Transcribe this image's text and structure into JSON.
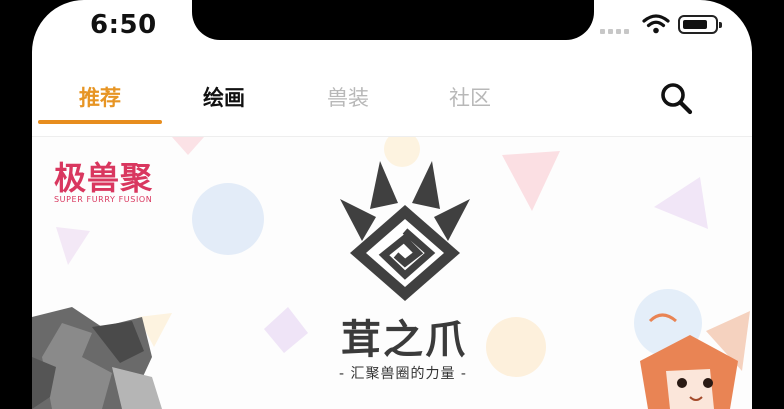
{
  "status_bar": {
    "time": "6:50"
  },
  "tabs": [
    {
      "label": "推荐",
      "active": true
    },
    {
      "label": "绘画",
      "active": false
    },
    {
      "label": "兽装",
      "active": false
    },
    {
      "label": "社区",
      "active": false
    }
  ],
  "icons": {
    "search": "search-icon",
    "wifi": "wifi-icon",
    "battery": "battery-icon"
  },
  "banner": {
    "left_logo": "极兽聚",
    "left_logo_sub": "SUPER FURRY FUSION",
    "title": "茸之爪",
    "subtitle": "- 汇聚兽圈的力量 -"
  },
  "colors": {
    "accent": "#e78d1e",
    "logo_pink": "#d9375f",
    "muted_tab": "#b8b8b8"
  }
}
